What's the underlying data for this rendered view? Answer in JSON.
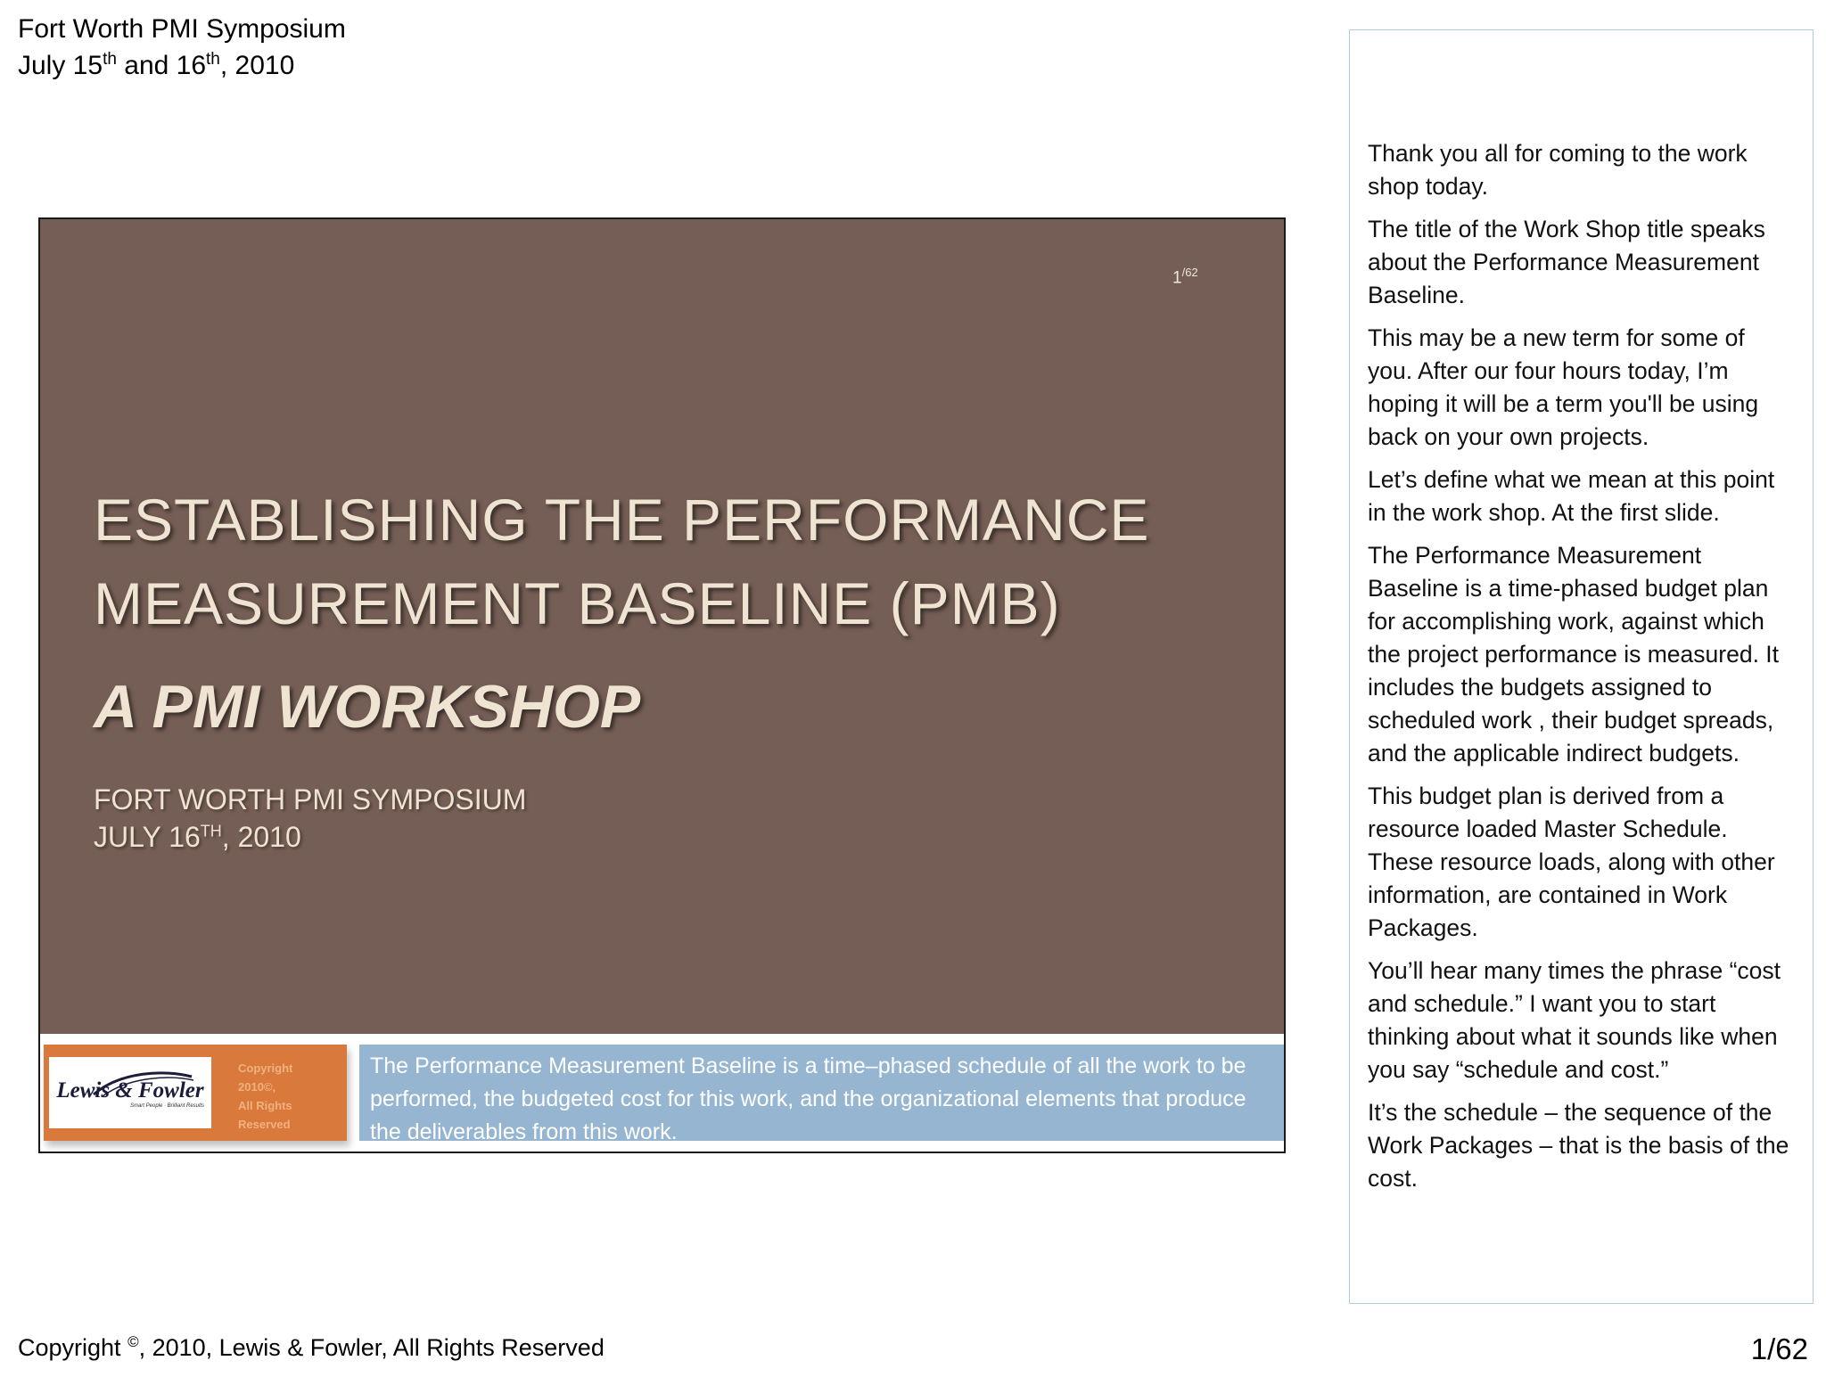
{
  "header": {
    "line1": "Fort Worth PMI Symposium",
    "line2_prefix": "July 15",
    "line2_sup1": "th",
    "line2_mid": " and 16",
    "line2_sup2": "th",
    "line2_suffix": ", 2010"
  },
  "slide": {
    "number": "1",
    "total": "/62",
    "title_line1": "ESTABLISHING THE PERFORMANCE",
    "title_line2": "MEASUREMENT BASELINE (PMB)",
    "subtitle": "A PMI WORKSHOP",
    "event_line1": "FORT WORTH PMI SYMPOSIUM",
    "event_line2_prefix": "JULY 16",
    "event_line2_sup": "TH",
    "event_line2_suffix": ", 2010",
    "logo_name": "Lewis & Fowler",
    "logo_tagline": "Smart People · Brilliant Results",
    "copyright_lines": [
      "Copyright",
      "2010©,",
      "All Rights",
      "Reserved"
    ],
    "footer_text": "The Performance Measurement Baseline is a time–phased schedule of all the work to be performed, the budgeted cost for this work, and the organizational elements that produce the deliverables from this work.",
    "colors": {
      "slide_bg": "#755e55",
      "orange": "#d9793c",
      "blue": "#95b5d1",
      "title_text": "#efe3d2"
    }
  },
  "notes": [
    "Thank you all for coming to the work shop today.",
    "The title of the Work Shop title speaks about the Performance Measurement Baseline.",
    "This may be a new term for some of you. After our four hours today, I’m hoping it will be a term you'll be using back on your own projects.",
    "Let’s define what we mean at this point in the work shop. At the first slide.",
    "The Performance Measurement Baseline is a time-phased budget plan for accomplishing work, against which the project performance is measured. It includes the budgets assigned to scheduled work , their budget spreads, and the applicable indirect budgets.",
    "This budget plan is derived from a resource loaded Master Schedule. These resource loads, along with other information, are contained in Work Packages.",
    "You’ll hear many times the phrase “cost and schedule.” I want you to start thinking about what it sounds like when you say “schedule and cost.”",
    "It’s the schedule – the sequence of the Work Packages – that is the basis of the cost."
  ],
  "footer": {
    "copyright_prefix": "Copyright ",
    "copyright_symbol": "©",
    "copyright_suffix": ", 2010, Lewis & Fowler, All Rights Reserved",
    "page": "1/62"
  }
}
